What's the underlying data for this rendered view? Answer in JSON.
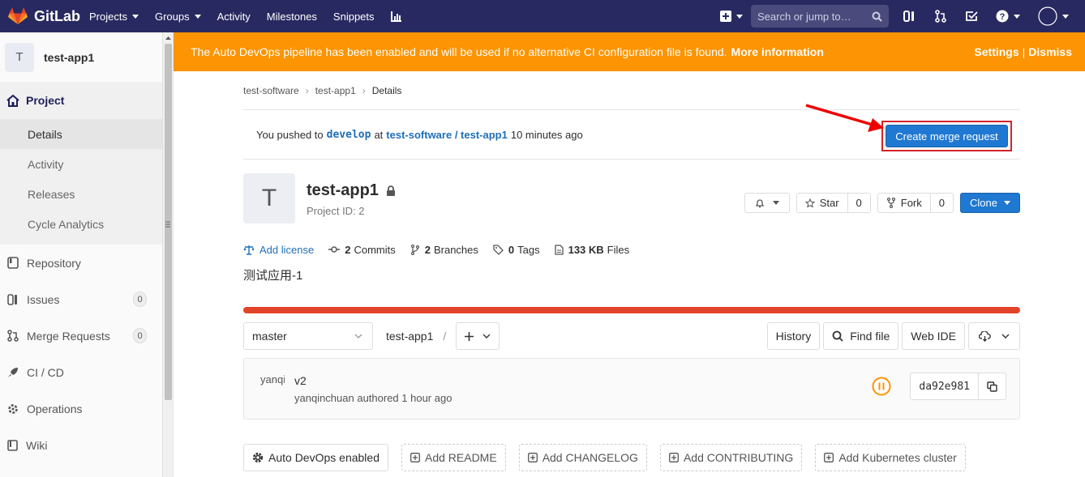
{
  "topbar": {
    "brand": "GitLab",
    "nav": [
      {
        "label": "Projects",
        "caret": true
      },
      {
        "label": "Groups",
        "caret": true
      },
      {
        "label": "Activity",
        "caret": false
      },
      {
        "label": "Milestones",
        "caret": false
      },
      {
        "label": "Snippets",
        "caret": false
      }
    ],
    "search_placeholder": "Search or jump to…"
  },
  "sidebar": {
    "avatar_letter": "T",
    "project_name": "test-app1",
    "section": "Project",
    "subitems": [
      "Details",
      "Activity",
      "Releases",
      "Cycle Analytics"
    ],
    "items": [
      {
        "label": "Repository",
        "count": null
      },
      {
        "label": "Issues",
        "count": "0"
      },
      {
        "label": "Merge Requests",
        "count": "0"
      },
      {
        "label": "CI / CD",
        "count": null
      },
      {
        "label": "Operations",
        "count": null
      },
      {
        "label": "Wiki",
        "count": null
      }
    ]
  },
  "banner": {
    "text": "The Auto DevOps pipeline has been enabled and will be used if no alternative CI configuration file is found.",
    "link": "More information",
    "settings": "Settings",
    "separator": "|",
    "dismiss": "Dismiss"
  },
  "breadcrumb": [
    "test-software",
    "test-app1",
    "Details"
  ],
  "push": {
    "prefix": "You pushed to",
    "branch": "develop",
    "at": "at",
    "repo": "test-software / test-app1",
    "time": "10 minutes ago",
    "button": "Create merge request"
  },
  "project": {
    "avatar_letter": "T",
    "title": "test-app1",
    "id_label": "Project ID: 2",
    "star": "Star",
    "star_count": "0",
    "fork": "Fork",
    "fork_count": "0",
    "clone": "Clone"
  },
  "stats": {
    "license": "Add license",
    "commits_n": "2",
    "commits": "Commits",
    "branches_n": "2",
    "branches": "Branches",
    "tags_n": "0",
    "tags": "Tags",
    "size_n": "133 KB",
    "size": "Files"
  },
  "description": "测试应用-1",
  "tree": {
    "branch": "master",
    "path": "test-app1",
    "sep": "/",
    "history": "History",
    "find_file": "Find file",
    "web_ide": "Web IDE"
  },
  "commit": {
    "avatar_text": "yanqinchuan",
    "title": "v2",
    "author": "yanqinchuan authored 1 hour ago",
    "sha": "da92e981"
  },
  "bottom": {
    "autodevops": "Auto DevOps enabled",
    "readme": "Add README",
    "changelog": "Add CHANGELOG",
    "contributing": "Add CONTRIBUTING",
    "k8s": "Add Kubernetes cluster"
  },
  "colors": {
    "header": "#292961",
    "banner": "#fc9403",
    "primary": "#1f78d1",
    "progress": "#e24329",
    "highlight": "#d5232a"
  }
}
